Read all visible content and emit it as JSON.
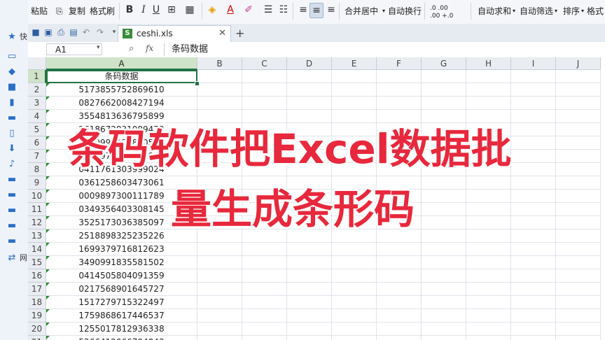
{
  "ribbon": {
    "paste_label": "粘贴",
    "copy_label": "复制",
    "format_painter_label": "格式刷",
    "bold": "B",
    "italic": "I",
    "underline": "U",
    "merge_center_label": "合并居中",
    "wrap_text_label": "自动换行",
    "autosum_label": "自动求和",
    "autofilter_label": "自动筛选",
    "sort_label": "排序",
    "format_label": "格式",
    "dec_increase": ".0 .00",
    "dec_decrease": ".00 +.0"
  },
  "tabbar": {
    "file_tab": "ceshi.xls",
    "new_tab_symbol": "+"
  },
  "formula_bar": {
    "name_box": "A1",
    "fx": "fx",
    "formula": "条码数据"
  },
  "grid": {
    "columns": [
      "A",
      "B",
      "C",
      "D",
      "E",
      "F",
      "G",
      "H",
      "I",
      "J"
    ],
    "rows": [
      {
        "n": "1",
        "a": "条码数据"
      },
      {
        "n": "2",
        "a": "5173855752869610"
      },
      {
        "n": "3",
        "a": "0827662008427194"
      },
      {
        "n": "4",
        "a": "3554813636795899"
      },
      {
        "n": "5",
        "a": "2618672831089472"
      },
      {
        "n": "6",
        "a": "5249997135840582"
      },
      {
        "n": "7",
        "a": "1928979161032969"
      },
      {
        "n": "8",
        "a": "0411761303999024"
      },
      {
        "n": "9",
        "a": "0361258603473061"
      },
      {
        "n": "10",
        "a": "0009897300111789"
      },
      {
        "n": "11",
        "a": "0349356403308145"
      },
      {
        "n": "12",
        "a": "3525173036385097"
      },
      {
        "n": "13",
        "a": "2518898325235226"
      },
      {
        "n": "14",
        "a": "1699379716812623"
      },
      {
        "n": "15",
        "a": "3490991835581502"
      },
      {
        "n": "16",
        "a": "0414505804091359"
      },
      {
        "n": "17",
        "a": "0217568901645727"
      },
      {
        "n": "18",
        "a": "1517279715322497"
      },
      {
        "n": "19",
        "a": "1759868617446537"
      },
      {
        "n": "20",
        "a": "1255017812936338"
      },
      {
        "n": "21",
        "a": "5266412066704043"
      }
    ]
  },
  "overlay": {
    "line1": "条码软件把Excel数据批",
    "line2": "量生成条形码"
  },
  "colors": {
    "accent_green": "#217346",
    "caption_red": "#e8283c"
  },
  "left_panel": {
    "item1": "快",
    "item2": "网"
  }
}
